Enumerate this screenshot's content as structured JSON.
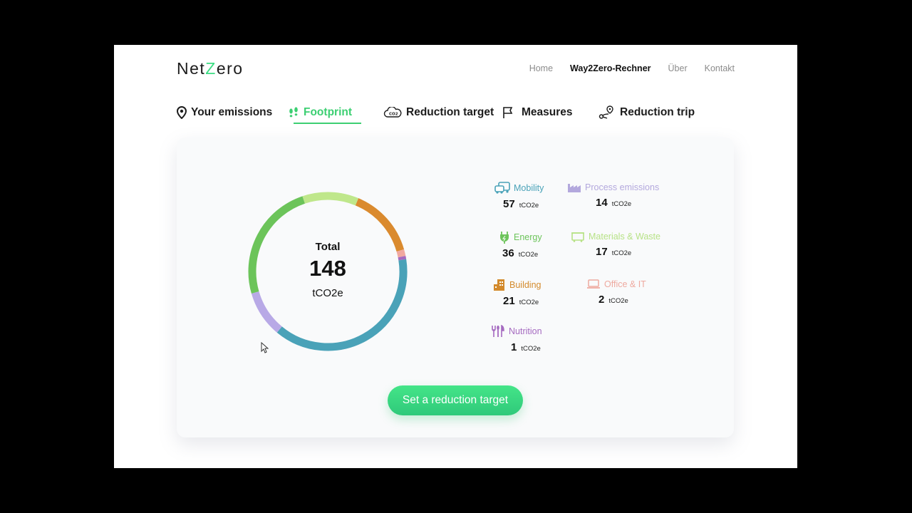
{
  "header": {
    "logo_a": "Net",
    "logo_z": "Z",
    "logo_b": "ero",
    "nav": [
      "Home",
      "Way2Zero-Rechner",
      "Über",
      "Kontakt"
    ]
  },
  "tabs": [
    {
      "label": "Your emissions",
      "icon": "location-pin-icon"
    },
    {
      "label": "Footprint",
      "icon": "footsteps-icon",
      "active": true
    },
    {
      "label": "Reduction target",
      "icon": "co2-cloud-icon"
    },
    {
      "label": "Measures",
      "icon": "flag-icon"
    },
    {
      "label": "Reduction trip",
      "icon": "route-icon"
    }
  ],
  "total": {
    "label": "Total",
    "value": "148",
    "unit": "tCO2e"
  },
  "chart_data": {
    "type": "pie",
    "total": 148,
    "segments": [
      {
        "name": "Mobility",
        "value": 57,
        "color": "#4aa2b8"
      },
      {
        "name": "Process emissions",
        "value": 14,
        "color": "#b8a9e6"
      },
      {
        "name": "Energy",
        "value": 36,
        "color": "#6cc45a"
      },
      {
        "name": "Materials & Waste",
        "value": 17,
        "color": "#bfe78b"
      },
      {
        "name": "Building",
        "value": 21,
        "color": "#da8a2e"
      },
      {
        "name": "Office & IT",
        "value": 2,
        "color": "#f1a8a0"
      },
      {
        "name": "Nutrition",
        "value": 1,
        "color": "#a56ac0"
      }
    ]
  },
  "categories": [
    {
      "name": "Mobility",
      "value": "57",
      "unit": "tCO2e",
      "color": "#4aa2b8",
      "icon": "vehicles-icon"
    },
    {
      "name": "Process emissions",
      "value": "14",
      "unit": "tCO2e",
      "color": "#b3a8dd",
      "icon": "factory-icon"
    },
    {
      "name": "Energy",
      "value": "36",
      "unit": "tCO2e",
      "color": "#6cc45a",
      "icon": "plug-icon"
    },
    {
      "name": "Materials & Waste",
      "value": "17",
      "unit": "tCO2e",
      "color": "#b7e286",
      "icon": "container-icon"
    },
    {
      "name": "Building",
      "value": "21",
      "unit": "tCO2e",
      "color": "#d38a2c",
      "icon": "building-icon"
    },
    {
      "name": "Office & IT",
      "value": "2",
      "unit": "tCO2e",
      "color": "#eea99f",
      "icon": "laptop-icon"
    },
    {
      "name": "Nutrition",
      "value": "1",
      "unit": "tCO2e",
      "color": "#a56ac0",
      "icon": "cutlery-icon"
    }
  ],
  "cta": {
    "label": "Set a reduction target"
  }
}
